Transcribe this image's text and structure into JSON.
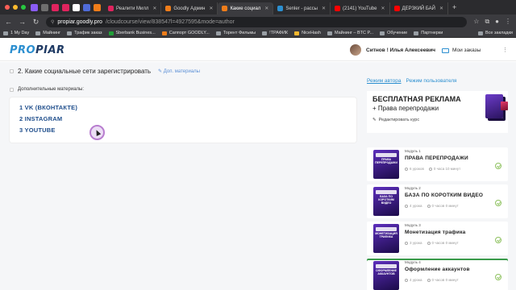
{
  "browser": {
    "tabs": [
      {
        "label": "Реалити Милл",
        "active": false
      },
      {
        "label": "Goodly Админ",
        "active": false
      },
      {
        "label": "Какие социал",
        "active": true
      },
      {
        "label": "Senler - рассы",
        "active": false
      },
      {
        "label": "(2141) YouTube",
        "active": false
      },
      {
        "label": "ДЕРЗКИЙ БАЙ",
        "active": false
      }
    ],
    "url_host": "propiar.goodly.pro",
    "url_path": "/cloudcourse/view/838547l=4927595&mode=author",
    "bookmarks": [
      "1 My Day",
      "Майнинг",
      "Трафик заказ",
      "Sberbank Busines...",
      "Саппорт GOODLY...",
      "Торент Фильмы",
      "!ТРАФИК",
      "NiceHash",
      "Майнинг – BTC P...",
      "Обучение",
      "Партнерки"
    ],
    "bookmarks_all": "Все закладки"
  },
  "header": {
    "logo_part1": "PRO",
    "logo_part2": "PIAR",
    "user_name": "Ситнов ! Илья Алексеевич",
    "orders_label": "Мои заказы"
  },
  "lesson": {
    "title": "2. Какие социальные сети зарегистрировать",
    "edit_label": "Доп. материалы",
    "materials_label": "Дополнительные материалы:",
    "items": [
      "1 VK (ВКОНТАКТЕ)",
      "2 INSTAGRAM",
      "3 YOUTUBE"
    ]
  },
  "sidebar": {
    "mode_author": "Режим автора",
    "mode_user": "Режим пользователя",
    "promo_title": "БЕСПЛАТНАЯ РЕКЛАМА",
    "promo_subtitle": "+ Права перепродажи",
    "promo_edit": "Редактировать курс",
    "modules": [
      {
        "num": "Модуль 1",
        "title": "ПРАВА ПЕРЕПРОДАЖИ",
        "lessons": "6 уроков",
        "time": "0 часа 10 минут",
        "thumb": "ПРАВА ПЕРЕПРОДАЖИ"
      },
      {
        "num": "Модуль 2",
        "title": "БАЗА ПО КОРОТКИМ ВИДЕО",
        "lessons": "4 урока",
        "time": "0 часов 0 минут",
        "thumb": "БАЗА ПО КОРОТКИМ ВИДЕО"
      },
      {
        "num": "Модуль 3",
        "title": "Монетизация трафика",
        "lessons": "3 урока",
        "time": "0 часов 0 минут",
        "thumb": "МОНЕТИЗАЦИЯ ТРАФИКА"
      },
      {
        "num": "Модуль 4",
        "title": "Оформление аккаунтов",
        "lessons": "4 урока",
        "time": "0 часов 0 минут",
        "thumb": "ОФОРМЛЕНИЕ АККАУНТОВ"
      }
    ]
  },
  "colors": {
    "accent": "#2c8fd0",
    "link": "#1f4e8c",
    "success": "#8ec15f"
  }
}
